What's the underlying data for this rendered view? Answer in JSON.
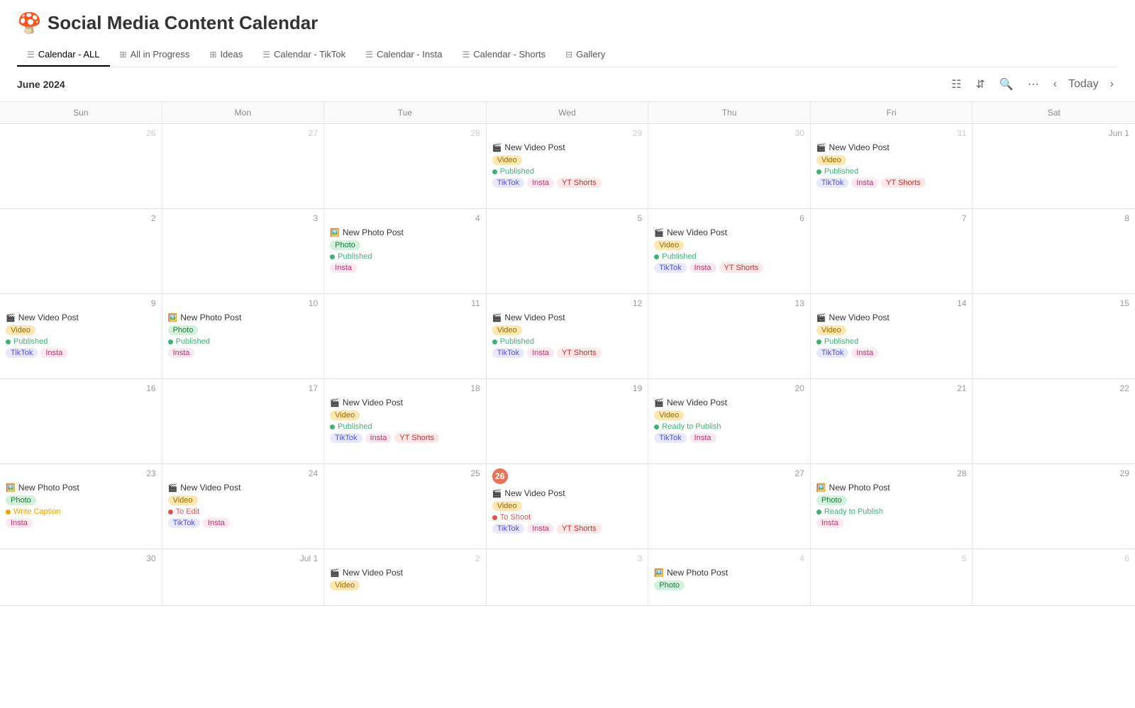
{
  "app": {
    "title": "Social Media Content Calendar",
    "emoji": "🍄"
  },
  "tabs": [
    {
      "id": "calendar-all",
      "label": "Calendar - ALL",
      "icon": "☰",
      "active": true
    },
    {
      "id": "all-in-progress",
      "label": "All in Progress",
      "icon": "⊞",
      "active": false
    },
    {
      "id": "ideas",
      "label": "Ideas",
      "icon": "⊞",
      "active": false
    },
    {
      "id": "calendar-tiktok",
      "label": "Calendar - TikTok",
      "icon": "☰",
      "active": false
    },
    {
      "id": "calendar-insta",
      "label": "Calendar - Insta",
      "icon": "☰",
      "active": false
    },
    {
      "id": "calendar-shorts",
      "label": "Calendar - Shorts",
      "icon": "☰",
      "active": false
    },
    {
      "id": "gallery",
      "label": "Gallery",
      "icon": "⊞",
      "active": false
    }
  ],
  "toolbar": {
    "month_label": "June 2024",
    "today_label": "Today"
  },
  "calendar": {
    "headers": [
      "Sun",
      "Mon",
      "Tue",
      "Wed",
      "Thu",
      "Fri",
      "Sat"
    ],
    "rows": [
      [
        {
          "date": "26",
          "other_month": true,
          "today": false,
          "events": []
        },
        {
          "date": "27",
          "other_month": true,
          "today": false,
          "events": []
        },
        {
          "date": "28",
          "other_month": true,
          "today": false,
          "events": []
        },
        {
          "date": "29",
          "other_month": true,
          "today": false,
          "events": [
            {
              "title": "New Video Post",
              "emoji": "🎬",
              "type_tag": "video",
              "status": "published",
              "status_label": "Published",
              "platforms": [
                "tiktok",
                "insta",
                "ytshorts"
              ]
            }
          ]
        },
        {
          "date": "30",
          "other_month": true,
          "today": false,
          "events": []
        },
        {
          "date": "31",
          "other_month": true,
          "today": false,
          "events": [
            {
              "title": "New Video Post",
              "emoji": "🎬",
              "type_tag": "video",
              "status": "published",
              "status_label": "Published",
              "platforms": [
                "tiktok",
                "insta",
                "ytshorts"
              ]
            }
          ]
        },
        {
          "date": "Jun 1",
          "other_month": false,
          "today": false,
          "events": []
        }
      ],
      [
        {
          "date": "2",
          "other_month": false,
          "today": false,
          "events": []
        },
        {
          "date": "3",
          "other_month": false,
          "today": false,
          "events": []
        },
        {
          "date": "4",
          "other_month": false,
          "today": false,
          "events": [
            {
              "title": "New Photo Post",
              "emoji": "🖼️",
              "type_tag": "photo",
              "status": "published",
              "status_label": "Published",
              "platforms": [
                "insta"
              ]
            }
          ]
        },
        {
          "date": "5",
          "other_month": false,
          "today": false,
          "events": []
        },
        {
          "date": "6",
          "other_month": false,
          "today": false,
          "events": [
            {
              "title": "New Video Post",
              "emoji": "🎬",
              "type_tag": "video",
              "status": "published",
              "status_label": "Published",
              "platforms": [
                "tiktok",
                "insta",
                "ytshorts"
              ]
            }
          ]
        },
        {
          "date": "7",
          "other_month": false,
          "today": false,
          "events": []
        },
        {
          "date": "8",
          "other_month": false,
          "today": false,
          "events": []
        }
      ],
      [
        {
          "date": "9",
          "other_month": false,
          "today": false,
          "events": [
            {
              "title": "New Video Post",
              "emoji": "🎬",
              "type_tag": "video",
              "status": "published",
              "status_label": "Published",
              "platforms": [
                "tiktok",
                "insta"
              ]
            }
          ]
        },
        {
          "date": "10",
          "other_month": false,
          "today": false,
          "events": [
            {
              "title": "New Photo Post",
              "emoji": "🖼️",
              "type_tag": "photo",
              "status": "published",
              "status_label": "Published",
              "platforms": [
                "insta"
              ]
            }
          ]
        },
        {
          "date": "11",
          "other_month": false,
          "today": false,
          "events": []
        },
        {
          "date": "12",
          "other_month": false,
          "today": false,
          "events": [
            {
              "title": "New Video Post",
              "emoji": "🎬",
              "type_tag": "video",
              "status": "published",
              "status_label": "Published",
              "platforms": [
                "tiktok",
                "insta",
                "ytshorts"
              ]
            }
          ]
        },
        {
          "date": "13",
          "other_month": false,
          "today": false,
          "events": []
        },
        {
          "date": "14",
          "other_month": false,
          "today": false,
          "events": [
            {
              "title": "New Video Post",
              "emoji": "🎬",
              "type_tag": "video",
              "status": "published",
              "status_label": "Published",
              "platforms": [
                "tiktok",
                "insta"
              ]
            }
          ]
        },
        {
          "date": "15",
          "other_month": false,
          "today": false,
          "events": []
        }
      ],
      [
        {
          "date": "16",
          "other_month": false,
          "today": false,
          "events": []
        },
        {
          "date": "17",
          "other_month": false,
          "today": false,
          "events": []
        },
        {
          "date": "18",
          "other_month": false,
          "today": false,
          "events": [
            {
              "title": "New Video Post",
              "emoji": "🎬",
              "type_tag": "video",
              "status": "published",
              "status_label": "Published",
              "platforms": [
                "tiktok",
                "insta",
                "ytshorts"
              ]
            }
          ]
        },
        {
          "date": "19",
          "other_month": false,
          "today": false,
          "events": []
        },
        {
          "date": "20",
          "other_month": false,
          "today": false,
          "events": [
            {
              "title": "New Video Post",
              "emoji": "🎬",
              "type_tag": "video",
              "status": "ready",
              "status_label": "Ready to Publish",
              "platforms": [
                "tiktok",
                "insta"
              ]
            }
          ]
        },
        {
          "date": "21",
          "other_month": false,
          "today": false,
          "events": []
        },
        {
          "date": "22",
          "other_month": false,
          "today": false,
          "events": []
        }
      ],
      [
        {
          "date": "23",
          "other_month": false,
          "today": false,
          "events": [
            {
              "title": "New Photo Post",
              "emoji": "🖼️",
              "type_tag": "photo",
              "status": "write-caption",
              "status_label": "Write Caption",
              "platforms": [
                "insta"
              ]
            }
          ]
        },
        {
          "date": "24",
          "other_month": false,
          "today": false,
          "events": [
            {
              "title": "New Video Post",
              "emoji": "🎬",
              "type_tag": "video",
              "status": "to-edit",
              "status_label": "To Edit",
              "platforms": [
                "tiktok",
                "insta"
              ]
            }
          ]
        },
        {
          "date": "25",
          "other_month": false,
          "today": false,
          "events": []
        },
        {
          "date": "26",
          "other_month": false,
          "today": true,
          "events": [
            {
              "title": "New Video Post",
              "emoji": "🎬",
              "type_tag": "video",
              "status": "to-shoot",
              "status_label": "To Shoot",
              "platforms": [
                "tiktok",
                "insta",
                "ytshorts"
              ]
            }
          ]
        },
        {
          "date": "27",
          "other_month": false,
          "today": false,
          "events": []
        },
        {
          "date": "28",
          "other_month": false,
          "today": false,
          "events": [
            {
              "title": "New Photo Post",
              "emoji": "🖼️",
              "type_tag": "photo",
              "status": "ready",
              "status_label": "Ready to Publish",
              "platforms": [
                "insta"
              ]
            }
          ]
        },
        {
          "date": "29",
          "other_month": false,
          "today": false,
          "events": []
        }
      ],
      [
        {
          "date": "30",
          "other_month": false,
          "today": false,
          "events": []
        },
        {
          "date": "Jul 1",
          "other_month": false,
          "today": false,
          "events": []
        },
        {
          "date": "2",
          "other_month": true,
          "today": false,
          "events": [
            {
              "title": "New Video Post",
              "emoji": "🎬",
              "type_tag": "video",
              "status": "",
              "status_label": "",
              "platforms": []
            }
          ]
        },
        {
          "date": "3",
          "other_month": true,
          "today": false,
          "events": []
        },
        {
          "date": "4",
          "other_month": true,
          "today": false,
          "events": [
            {
              "title": "New Photo Post",
              "emoji": "🖼️",
              "type_tag": "photo",
              "status": "",
              "status_label": "",
              "platforms": []
            }
          ]
        },
        {
          "date": "5",
          "other_month": true,
          "today": false,
          "events": []
        },
        {
          "date": "6",
          "other_month": true,
          "today": false,
          "events": []
        }
      ]
    ]
  },
  "footer_button": "New Photo Post"
}
